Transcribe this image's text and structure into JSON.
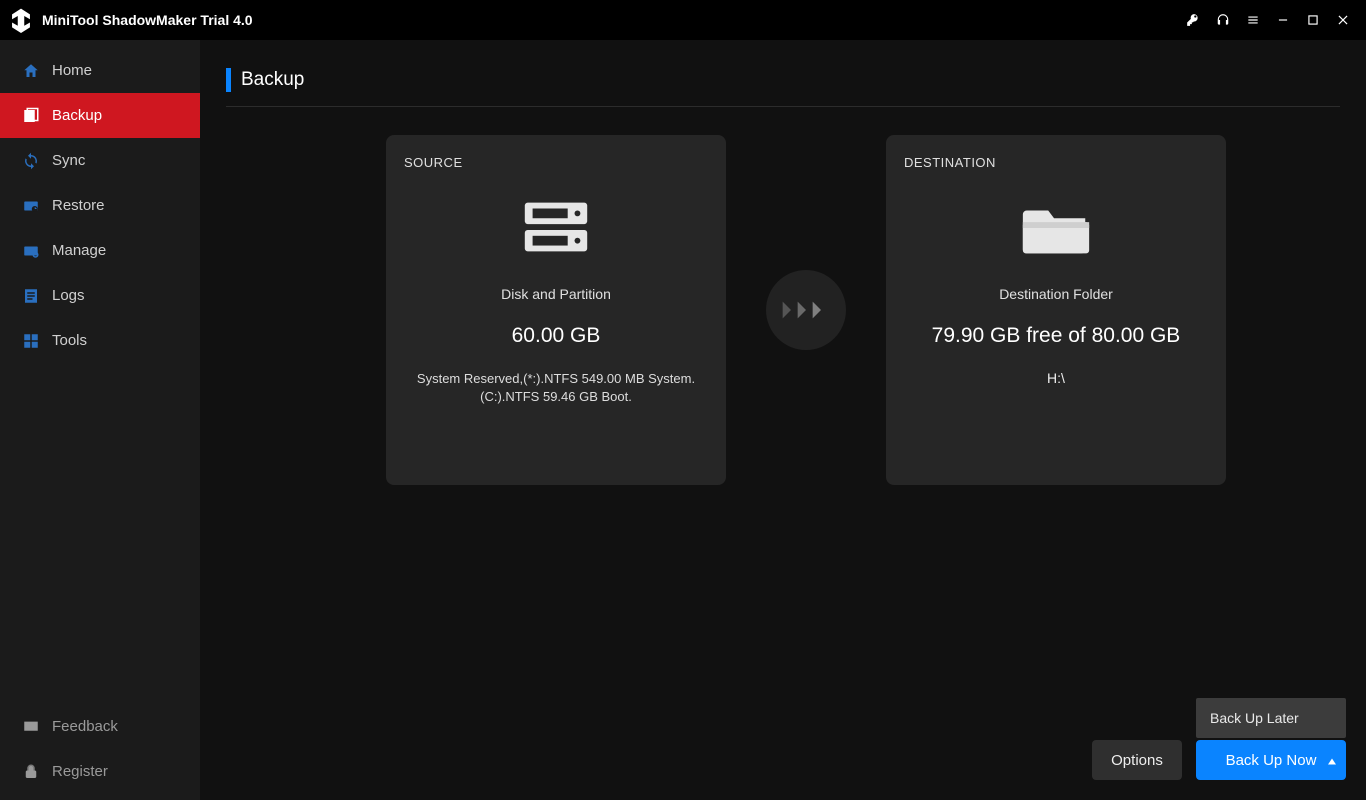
{
  "app": {
    "title": "MiniTool ShadowMaker Trial 4.0"
  },
  "sidebar": {
    "items": [
      {
        "label": "Home"
      },
      {
        "label": "Backup"
      },
      {
        "label": "Sync"
      },
      {
        "label": "Restore"
      },
      {
        "label": "Manage"
      },
      {
        "label": "Logs"
      },
      {
        "label": "Tools"
      }
    ],
    "bottom": [
      {
        "label": "Feedback"
      },
      {
        "label": "Register"
      }
    ]
  },
  "page": {
    "title": "Backup"
  },
  "source": {
    "heading": "SOURCE",
    "type": "Disk and Partition",
    "size": "60.00 GB",
    "detail": "System Reserved,(*:).NTFS 549.00 MB System.(C:).NTFS 59.46 GB Boot."
  },
  "destination": {
    "heading": "DESTINATION",
    "type": "Destination Folder",
    "free": "79.90 GB free of 80.00 GB",
    "path": "H:\\"
  },
  "footer": {
    "options": "Options",
    "backup_now": "Back Up Now",
    "backup_later": "Back Up Later"
  }
}
